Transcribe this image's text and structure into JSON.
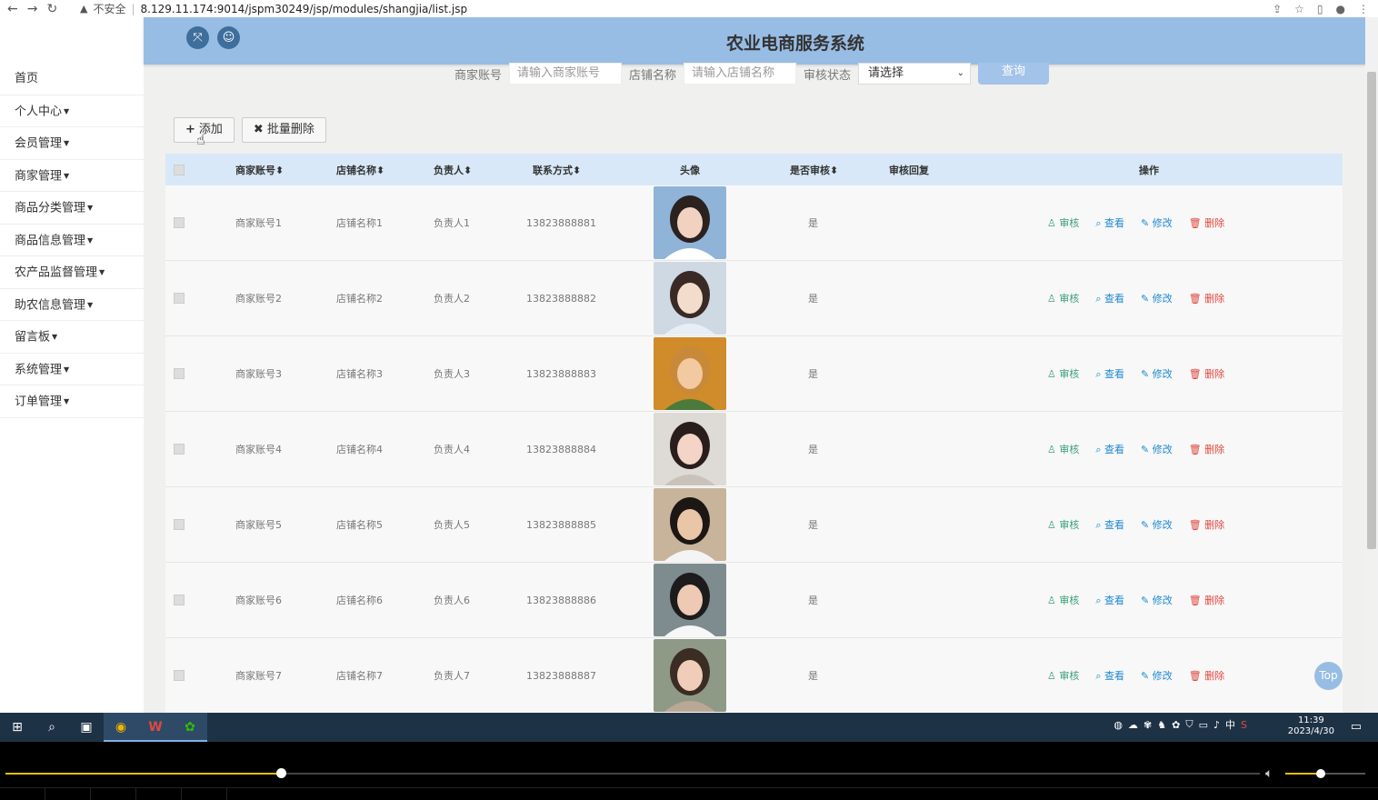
{
  "browser": {
    "security": "不安全",
    "url": "8.129.11.174:9014/jspm30249/jsp/modules/shangjia/list.jsp"
  },
  "header": {
    "title": "农业电商服务系统"
  },
  "sidebar": {
    "items": [
      {
        "label": "首页",
        "dropdown": false
      },
      {
        "label": "个人中心",
        "dropdown": true
      },
      {
        "label": "会员管理",
        "dropdown": true
      },
      {
        "label": "商家管理",
        "dropdown": true
      },
      {
        "label": "商品分类管理",
        "dropdown": true
      },
      {
        "label": "商品信息管理",
        "dropdown": true
      },
      {
        "label": "农产品监督管理",
        "dropdown": true
      },
      {
        "label": "助农信息管理",
        "dropdown": true
      },
      {
        "label": "留言板",
        "dropdown": true
      },
      {
        "label": "系统管理",
        "dropdown": true
      },
      {
        "label": "订单管理",
        "dropdown": true
      }
    ]
  },
  "search": {
    "account_label": "商家账号",
    "account_placeholder": "请输入商家账号",
    "shop_label": "店铺名称",
    "shop_placeholder": "请输入店铺名称",
    "status_label": "审核状态",
    "status_value": "请选择",
    "query_button": "查询"
  },
  "actions": {
    "add": "添加",
    "batch_delete": "批量删除"
  },
  "table": {
    "headers": {
      "account": "商家账号",
      "shop": "店铺名称",
      "owner": "负责人",
      "contact": "联系方式",
      "avatar": "头像",
      "reviewed": "是否审核",
      "reply": "审核回复",
      "ops": "操作"
    },
    "ops": {
      "review": "审核",
      "view": "查看",
      "edit": "修改",
      "delete": "删除"
    },
    "rows": [
      {
        "account": "商家账号1",
        "shop": "店铺名称1",
        "owner": "负责人1",
        "contact": "13823888881",
        "reviewed": "是",
        "reply": ""
      },
      {
        "account": "商家账号2",
        "shop": "店铺名称2",
        "owner": "负责人2",
        "contact": "13823888882",
        "reviewed": "是",
        "reply": ""
      },
      {
        "account": "商家账号3",
        "shop": "店铺名称3",
        "owner": "负责人3",
        "contact": "13823888883",
        "reviewed": "是",
        "reply": ""
      },
      {
        "account": "商家账号4",
        "shop": "店铺名称4",
        "owner": "负责人4",
        "contact": "13823888884",
        "reviewed": "是",
        "reply": ""
      },
      {
        "account": "商家账号5",
        "shop": "店铺名称5",
        "owner": "负责人5",
        "contact": "13823888885",
        "reviewed": "是",
        "reply": ""
      },
      {
        "account": "商家账号6",
        "shop": "店铺名称6",
        "owner": "负责人6",
        "contact": "13823888886",
        "reviewed": "是",
        "reply": ""
      },
      {
        "account": "商家账号7",
        "shop": "店铺名称7",
        "owner": "负责人7",
        "contact": "13823888887",
        "reviewed": "是",
        "reply": ""
      }
    ]
  },
  "top_button": "Top",
  "taskbar": {
    "time": "11:39",
    "date": "2023/4/30",
    "ime": "中"
  },
  "colors": {
    "header": "#98bde5",
    "review": "#3a9f78",
    "view": "#1e88d0",
    "delete": "#e0483e"
  }
}
